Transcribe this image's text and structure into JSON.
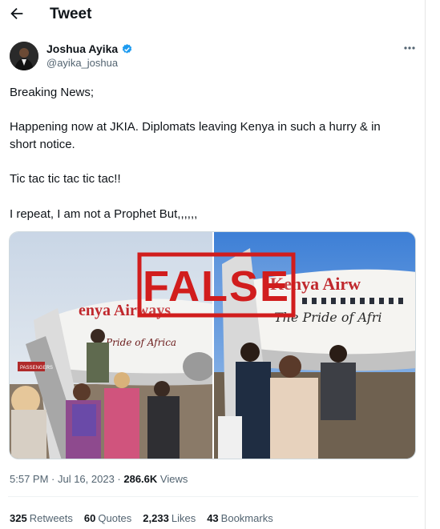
{
  "header": {
    "title": "Tweet"
  },
  "author": {
    "name": "Joshua Ayika",
    "handle": "@ayika_joshua"
  },
  "tweet": {
    "lines": [
      "Breaking News;",
      "Happening now at JKIA. Diplomats leaving Kenya in such a hurry & in",
      "short notice.",
      "Tic tac tic tac tic tac!!",
      "I repeat, I am not a Prophet But,,,,,,"
    ]
  },
  "media": {
    "stamp": "FALSE",
    "left_livery_1": "enya Airways",
    "left_livery_2": "Pride of Africa",
    "right_livery_1": "Kenya Airw",
    "right_livery_2": "The Pride of Afri",
    "sign_text": "PASSENGERS"
  },
  "meta": {
    "time": "5:57 PM · Jul 16, 2023 · ",
    "views_count": "286.6K",
    "views_label": "Views"
  },
  "stats": {
    "retweets": {
      "count": "325",
      "label": "Retweets"
    },
    "quotes": {
      "count": "60",
      "label": "Quotes"
    },
    "likes": {
      "count": "2,233",
      "label": "Likes"
    },
    "bookmarks": {
      "count": "43",
      "label": "Bookmarks"
    }
  },
  "colors": {
    "verified": "#1d9bf0",
    "stamp": "#d11d1d",
    "muted": "#536471"
  }
}
